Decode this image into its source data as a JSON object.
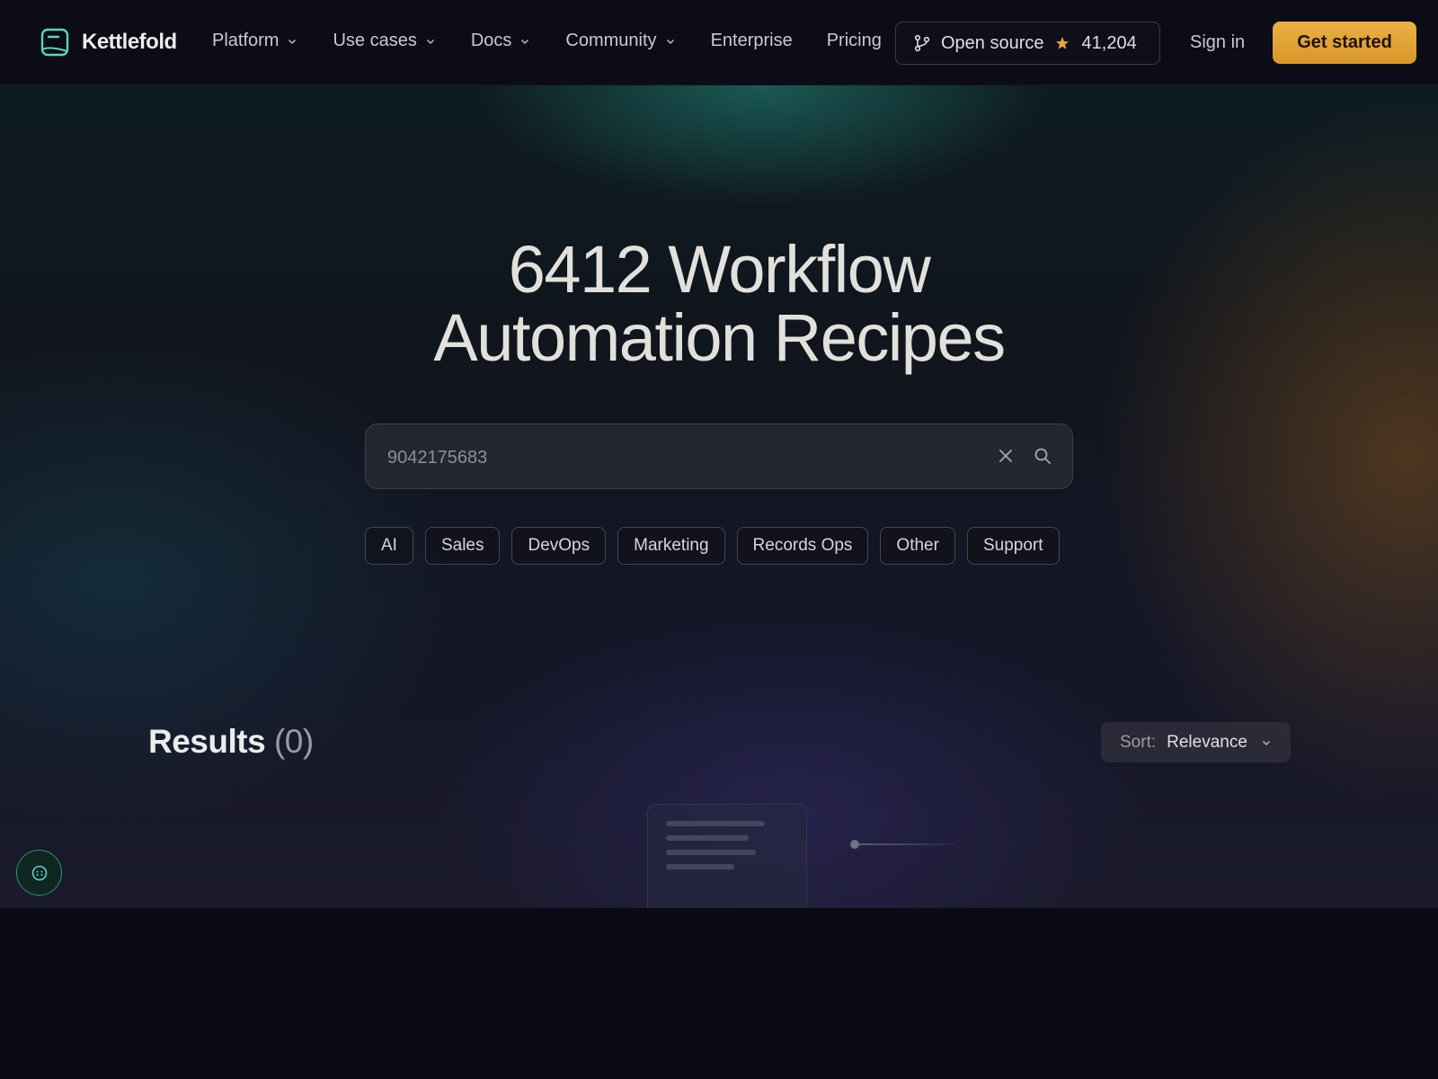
{
  "brand": {
    "name": "Kettlefold",
    "accent": "#5ed2be",
    "cta_color": "#e5a53a"
  },
  "nav": {
    "links": [
      {
        "label": "Platform",
        "dropdown": true
      },
      {
        "label": "Use cases",
        "dropdown": true
      },
      {
        "label": "Docs",
        "dropdown": true
      },
      {
        "label": "Community",
        "dropdown": true
      },
      {
        "label": "Enterprise",
        "dropdown": false
      },
      {
        "label": "Pricing",
        "dropdown": false
      }
    ],
    "open_source": {
      "label": "Open source",
      "stars": "41,204",
      "icon": "git-branch-icon",
      "star_icon": "star-icon"
    },
    "sign_in": "Sign in",
    "get_started": "Get started"
  },
  "hero": {
    "headline_line1": "6412 Workflow",
    "headline_line2": "Automation Recipes"
  },
  "search": {
    "value": "9042175683",
    "clear_icon": "close-icon",
    "search_icon": "search-icon"
  },
  "filters": [
    "AI",
    "Sales",
    "DevOps",
    "Marketing",
    "Records Ops",
    "Other",
    "Support"
  ],
  "results": {
    "title": "Results",
    "count": "(0)",
    "sort_label": "Sort:",
    "sort_value": "Relevance"
  }
}
